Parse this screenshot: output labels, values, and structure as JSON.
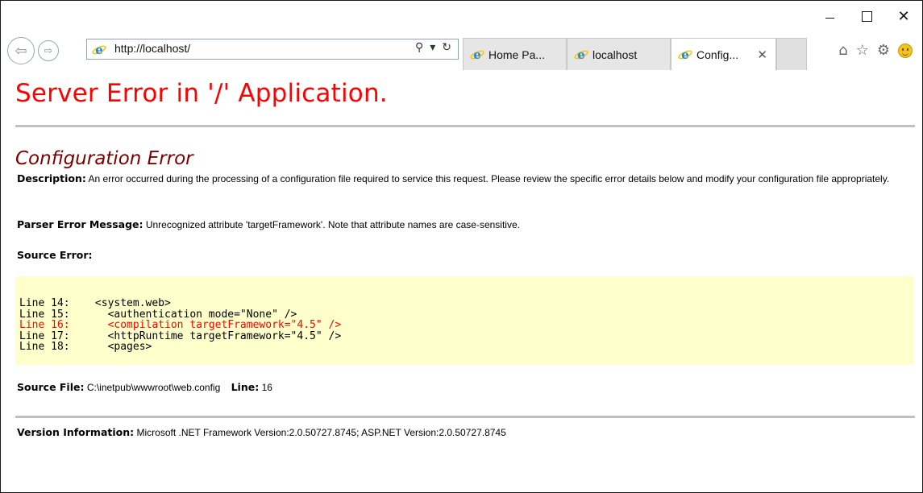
{
  "window": {
    "controls": {
      "minimize": "",
      "maximize": "",
      "close": "✕"
    }
  },
  "toolbar": {
    "address": {
      "url": "http://localhost/"
    },
    "tabs": [
      {
        "label": "Home Pa...",
        "active": false
      },
      {
        "label": "localhost",
        "active": false
      },
      {
        "label": "Config...",
        "active": true,
        "close": "✕"
      }
    ],
    "colors": {
      "ie_blue": "#1e88e5",
      "accent_gold": "#f2c417"
    }
  },
  "page": {
    "heading": "Server Error in '/' Application.",
    "error_title": "Configuration Error",
    "description_label": "Description:",
    "description_text": "An error occurred during the processing of a configuration file required to service this request. Please review the specific error details below and modify your configuration file appropriately.",
    "parser_label": "Parser Error Message:",
    "parser_text": "Unrecognized attribute 'targetFramework'. Note that attribute names are case-sensitive.",
    "source_error_label": "Source Error:",
    "source_lines": [
      {
        "text": "Line 14:    <system.web>",
        "highlight": false
      },
      {
        "text": "Line 15:      <authentication mode=\"None\" />",
        "highlight": false
      },
      {
        "text": "Line 16:      <compilation targetFramework=\"4.5\" />",
        "highlight": true
      },
      {
        "text": "Line 17:      <httpRuntime targetFramework=\"4.5\" />",
        "highlight": false
      },
      {
        "text": "Line 18:      <pages>",
        "highlight": false
      }
    ],
    "source_file_label": "Source File:",
    "source_file_value": "C:\\inetpub\\wwwroot\\web.config",
    "line_label": "Line:",
    "line_value": "16",
    "version_label": "Version Information:",
    "version_text": "Microsoft .NET Framework Version:2.0.50727.8745; ASP.NET Version:2.0.50727.8745",
    "colors": {
      "heading": "#ff0000",
      "error_title": "#800000",
      "code_bg": "#ffffcc",
      "highlight": "#ff0000"
    }
  }
}
